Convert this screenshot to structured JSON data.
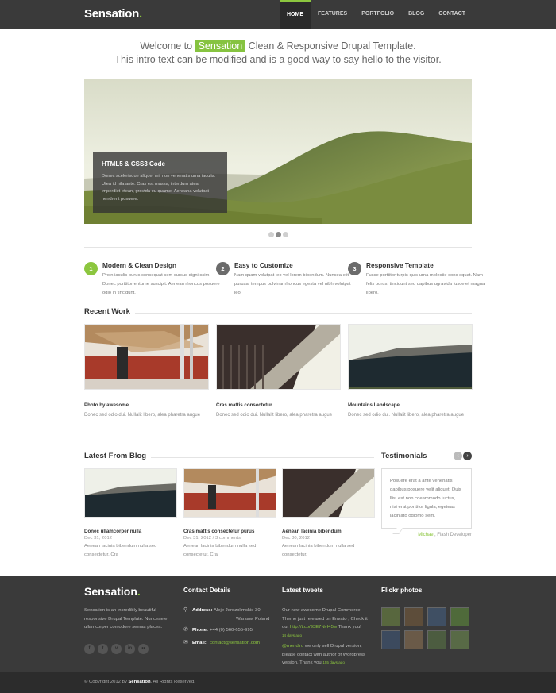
{
  "header": {
    "logo": "Sensation",
    "logo_dot": ".",
    "nav": [
      "HOME",
      "FEATURES",
      "PORTFOLIO",
      "BLOG",
      "CONTACT"
    ],
    "active": "HOME"
  },
  "intro": {
    "pre": "Welcome to ",
    "highlight": "Sensation",
    "post": " Clean & Responsive Drupal Template.",
    "line2": "This intro text can be modified and is a good way to say hello to the visitor."
  },
  "slider": {
    "title": "HTML5 & CSS3 Code",
    "text": "Donec scelerisque aliquet mi, non venenatis urna iaculis. Utea id nila ante. Cras est massa, interdum ateal imperdiet etean, gravida eu quame. Aeneana volutpat hendrerit posuere.",
    "dots": 3,
    "active_dot": 2
  },
  "features": [
    {
      "num": "1",
      "title": "Modern & Clean Design",
      "text": "Proin iaculis purus consequat sem cursus digni ssim. Donec porttitor entume suscipit. Aenean rhoncus posuere odio in tincidunt."
    },
    {
      "num": "2",
      "title": "Easy to Customize",
      "text": "Nam quam volutpat leo vel lorem bibendum. Nunceа elit purusa, tempus pulvinar rhoncus egesta vel nibh volutpat leo."
    },
    {
      "num": "3",
      "title": "Responsive Template",
      "text": "Fusce porttitor turpis quis urna molestie cons equat. Nam felis purus, tincidunt sed dapibus ugravida fusce et magna libero."
    }
  ],
  "recent_work": {
    "heading": "Recent Work",
    "items": [
      {
        "title": "Photo by awesome",
        "text": "Donec sed odio dui. Nullalit libero, alea pharetra augue"
      },
      {
        "title": "Cras mattis consectetur",
        "text": "Donec sed odio dui. Nullalit libero, alea pharetra augue"
      },
      {
        "title": "Mountains Landscape",
        "text": "Donec sed odio dui. Nullalit libero, alea pharetra augue"
      }
    ]
  },
  "blog": {
    "heading": "Latest From Blog",
    "posts": [
      {
        "title": "Donec ullamcorper nulla",
        "meta": "Dec 31, 2012",
        "text": "Aenean lacinia bibendum nulla sed consectetur. Cra"
      },
      {
        "title": "Cras mattis consectetur purus",
        "meta": "Dec 31, 2012 / 3 comments",
        "text": "Aenean lacinia bibendum nulla sed consectetur. Cra"
      },
      {
        "title": "Aenean lacinia bibendum",
        "meta": "Dec 30, 2012",
        "text": "Aenean lacinia bibendum nulla sed consectetur."
      }
    ]
  },
  "testimonials": {
    "heading": "Testimonials",
    "text": "Posuere erat a ante venenatis dapibus posuere velit aliquet. Duis llis, est non coeammodo luctus, nisi erat porttitor ligula, egeteas laciniato odiomo sem.",
    "author": "Michael",
    "role": ", Flash Developer",
    "prev": "‹",
    "next": "›"
  },
  "footer": {
    "logo": "Sensation",
    "logo_dot": ".",
    "about": "Sensation is an incredibly beautiful responsive Drupal Template. Nunceaele ullamcorper comodore semas placea.",
    "social": [
      "f",
      "t",
      "v",
      "in",
      "••"
    ],
    "contact_title": "Contact Details",
    "address_label": "Address:",
    "address": "Aleje Jerozolimskie 30,",
    "address2": "Warsaw, Poland",
    "phone_label": "Phone:",
    "phone": "+44 (0) 560-655-995",
    "email_label": "Email:",
    "email": "contact@sensation.com",
    "tweets_title": "Latest tweets",
    "tweet1": "Our new awesome Drupal Commerce Theme just released on Envato , Check it out ",
    "tweet1_link": "http://t.co/93E7NvI45w",
    "tweet1_end": " Thank you!",
    "tweet1_date": "14 days ago",
    "tweet2_user": "@mendiru",
    "tweet2": " we only sell Drupal version, please contact with author of Wordpress version. Thank you",
    "tweet2_date": "155 days ago",
    "flickr_title": "Flickr photos",
    "copyright_pre": "© Copyright 2012 by ",
    "copyright_brand": "Sensation",
    "copyright_post": ". All Rights Reserved."
  }
}
